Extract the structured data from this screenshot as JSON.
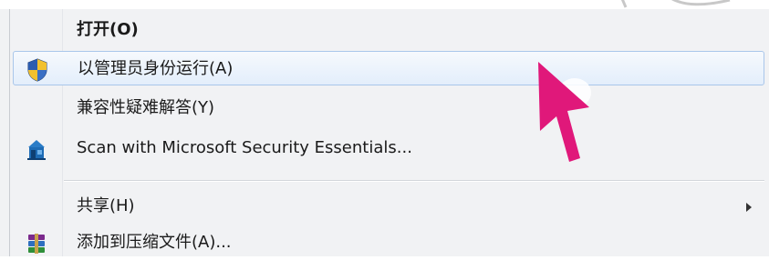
{
  "menu": {
    "items": [
      {
        "label": "打开(O)",
        "icon": "",
        "bold": true
      },
      {
        "label": "以管理员身份运行(A)",
        "icon": "uac-shield-icon",
        "highlighted": true
      },
      {
        "label": "兼容性疑难解答(Y)",
        "icon": ""
      },
      {
        "label": "Scan with Microsoft Security Essentials...",
        "icon": "security-essentials-icon"
      },
      {
        "label": "共享(H)",
        "icon": "",
        "has_submenu": true
      },
      {
        "label": "添加到压缩文件(A)...",
        "icon": "winrar-icon"
      }
    ]
  },
  "colors": {
    "menu_bg": "#f1f2f4",
    "highlight_border": "#a9c6ea",
    "cursor": "#e0187a"
  }
}
